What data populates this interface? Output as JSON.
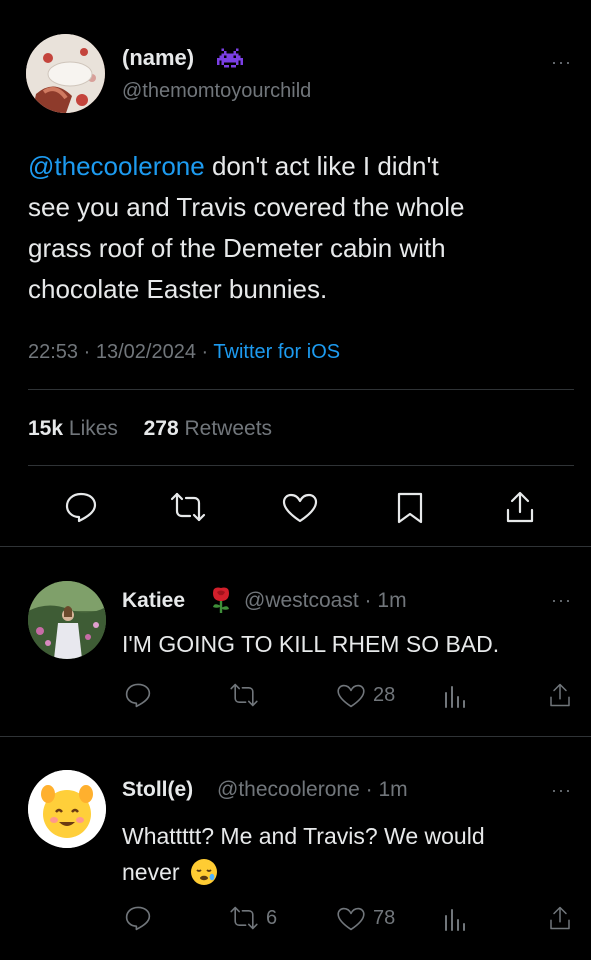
{
  "main_tweet": {
    "display_name": "(name)",
    "handle": "@themomtoyourchild",
    "mention": "@thecoolerone",
    "text_lines": [
      " don't act like I didn't",
      "see you and Travis covered the whole",
      "grass roof of the Demeter cabin with",
      "chocolate Easter bunnies."
    ],
    "time": "22:53",
    "date": "13/02/2024",
    "sep": "·",
    "source": "Twitter for iOS",
    "likes_count": "15k",
    "likes_label": "Likes",
    "retweets_count": "278",
    "retweets_label": "Retweets",
    "more": "···"
  },
  "replies": [
    {
      "display_name": "Katiee",
      "handle": "@westcoast",
      "sep": "·",
      "time": "1m",
      "text_lines": [
        "I'M GOING TO KILL RHEM SO BAD."
      ],
      "retweets": "",
      "likes": "28",
      "more": "···"
    },
    {
      "display_name": "Stoll(e)",
      "handle": "@thecoolerone",
      "sep": "·",
      "time": "1m",
      "text_lines": [
        "Whattttt? Me and Travis? We would",
        "never"
      ],
      "retweets": "6",
      "likes": "78",
      "more": "···"
    }
  ],
  "icons": {
    "header_badge": "space-invader-icon",
    "reply_1_badge": "rose-icon",
    "reply_2_emoji": "sleepy-face-icon"
  },
  "colors": {
    "background": "#000000",
    "text": "#e7e9ea",
    "muted": "#71767b",
    "link": "#1d9bf0",
    "divider": "#2f3336",
    "badge": "#7b3fe4"
  }
}
